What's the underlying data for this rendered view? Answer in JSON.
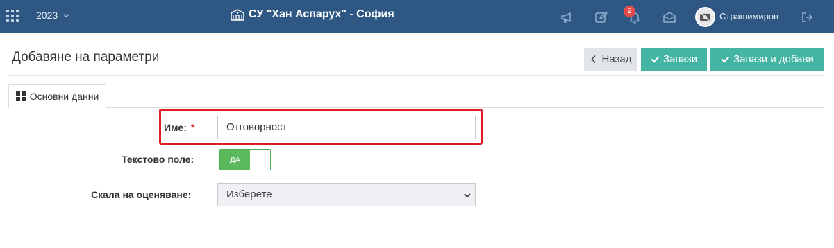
{
  "topbar": {
    "year": "2023",
    "school_name": "СУ \"Хан Аспарух\" - София",
    "notification_count": "2",
    "username": "Страшимиров",
    "icons": [
      "apps-grid-icon",
      "chevron-down-icon",
      "school-building-icon",
      "megaphone-icon",
      "edit-icon",
      "bell-icon",
      "envelope-open-icon",
      "avatar-icon",
      "logout-icon"
    ],
    "background_color": "#2e5883"
  },
  "page": {
    "title": "Добавяне на параметри"
  },
  "actions": {
    "back_label": "Назад",
    "save_label": "Запази",
    "save_add_label": "Запази и добави",
    "primary_color": "#45b5a3"
  },
  "tabs": [
    {
      "label": "Основни данни",
      "active": true
    }
  ],
  "form": {
    "name_label": "Име:",
    "name_required_mark": "*",
    "name_value": "Отговорност",
    "text_field_label": "Текстово поле:",
    "text_field_toggle": "ДА",
    "scale_label": "Скала на оценяване:",
    "scale_selected": "Изберете",
    "highlight_color": "#e01b24"
  }
}
